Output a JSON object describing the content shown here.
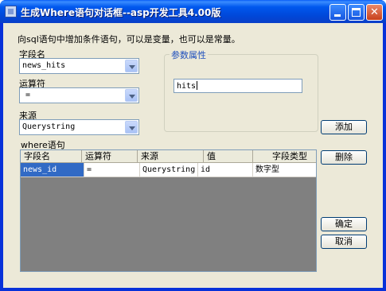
{
  "window": {
    "title": "生成Where语句对话框--asp开发工具4.00版"
  },
  "description": "向sql语句中增加条件语句，可以是变量，也可以是常量。",
  "field": {
    "label": "字段名",
    "value": "news_hits"
  },
  "operator": {
    "label": "运算符",
    "value": "="
  },
  "source": {
    "label": "来源",
    "value": "Querystring"
  },
  "params": {
    "group_title": "参数属性",
    "value": "hits"
  },
  "buttons": {
    "add": "添加",
    "delete": "删除",
    "ok": "确定",
    "cancel": "取消"
  },
  "where_grid": {
    "label": "where语句",
    "columns": [
      "字段名",
      "运算符",
      "来源",
      "值",
      "字段类型"
    ],
    "rows": [
      [
        "news_id",
        "=",
        "Querystring",
        "id",
        "数字型"
      ]
    ]
  }
}
